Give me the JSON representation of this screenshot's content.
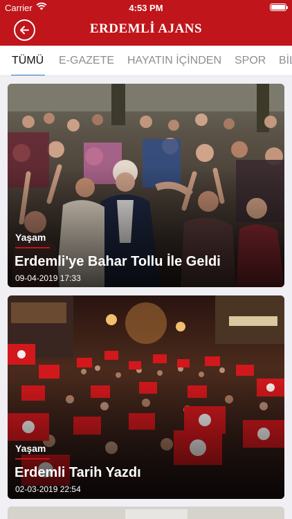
{
  "status_bar": {
    "carrier": "Carrier",
    "time": "4:53 PM",
    "battery_level": 1.0
  },
  "header": {
    "title": "ERDEMLİ AJANS",
    "back_icon": "arrow-left-icon",
    "background_color": "#c0151a"
  },
  "tabs": [
    {
      "label": "TÜMÜ",
      "active": true
    },
    {
      "label": "E-GAZETE",
      "active": false
    },
    {
      "label": "HAYATIN İÇİNDEN",
      "active": false
    },
    {
      "label": "SPOR",
      "active": false
    },
    {
      "label": "BİL",
      "active": false
    }
  ],
  "active_tab_indicator_color": "#2f7ad6",
  "articles": [
    {
      "category": "Yaşam",
      "title": "Erdemli'ye Bahar Tollu İle Geldi",
      "date": "09-04-2019 17:33"
    },
    {
      "category": "Yaşam",
      "title": "Erdemli Tarih Yazdı",
      "date": "02-03-2019 22:54"
    }
  ]
}
